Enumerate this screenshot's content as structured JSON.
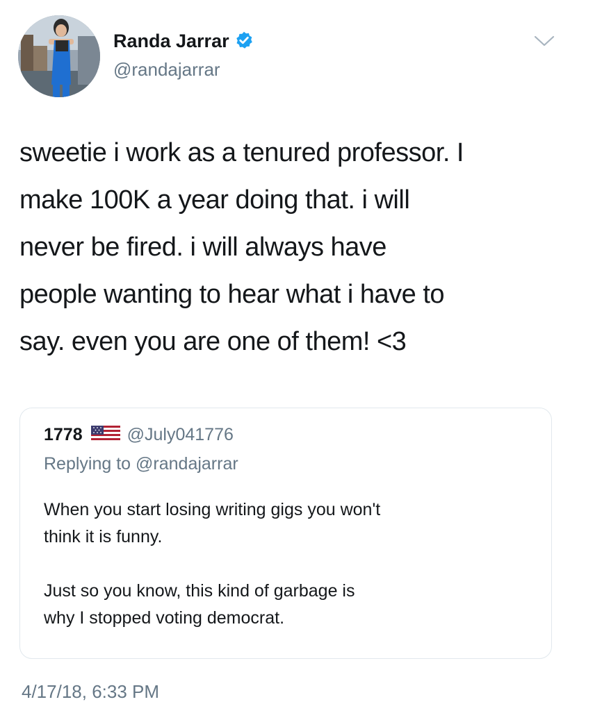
{
  "author": {
    "display_name": "Randa Jarrar",
    "handle": "@randajarrar",
    "verified": true,
    "avatar_icon": "profile-photo"
  },
  "tweet": {
    "text": "sweetie i work as a tenured professor. I\nmake 100K a year doing that. i will\nnever be fired. i will always have\npeople wanting to hear what i have to\nsay. even you are one of them! <3",
    "timestamp": "4/17/18, 6:33 PM"
  },
  "quoted_tweet": {
    "display_name": "1778",
    "flag_icon": "us-flag-icon",
    "handle": "@July041776",
    "replying_prefix": "Replying to ",
    "replying_to": "@randajarrar",
    "paragraphs": [
      "When you start losing writing gigs you won't\nthink it is funny.",
      "Just so you know, this kind of garbage is\nwhy I stopped voting democrat."
    ]
  },
  "icons": {
    "menu": "chevron-down-icon",
    "verified": "verified-badge-icon"
  },
  "colors": {
    "text": "#14171a",
    "secondary": "#657786",
    "verified_blue": "#1da1f2",
    "border": "#e1e8ed"
  }
}
